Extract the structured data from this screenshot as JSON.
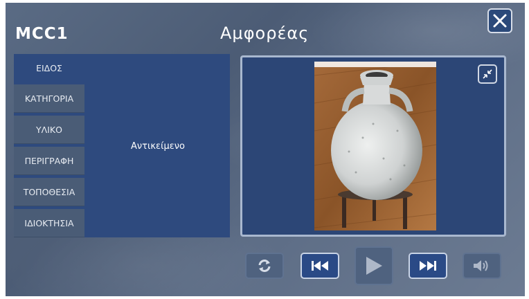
{
  "header": {
    "code": "MCC1",
    "title": "Αμφορέας"
  },
  "tabs": [
    {
      "label": "ΕΙΔΟΣ",
      "active": true
    },
    {
      "label": "ΚΑΤΗΓΟΡΙΑ",
      "active": false
    },
    {
      "label": "ΥΛΙΚΟ",
      "active": false
    },
    {
      "label": "ΠΕΡΙΓΡΑΦΗ",
      "active": false
    },
    {
      "label": "ΤΟΠΟΘΕΣΙΑ",
      "active": false
    },
    {
      "label": "ΙΔΙΟΚΤΗΣΙΑ",
      "active": false
    }
  ],
  "content": {
    "text": "Αντικείμενο"
  },
  "viewer": {
    "image_subject": "amphora-photo"
  },
  "controls": {
    "icons": [
      "refresh-icon",
      "skip-back-icon",
      "play-icon",
      "skip-forward-icon",
      "volume-icon"
    ]
  },
  "colors": {
    "panel": "#2e4a7e",
    "tab_inactive": "#4a5c76",
    "button_active": "#2a4a86",
    "button_disabled": "#4f627f"
  }
}
